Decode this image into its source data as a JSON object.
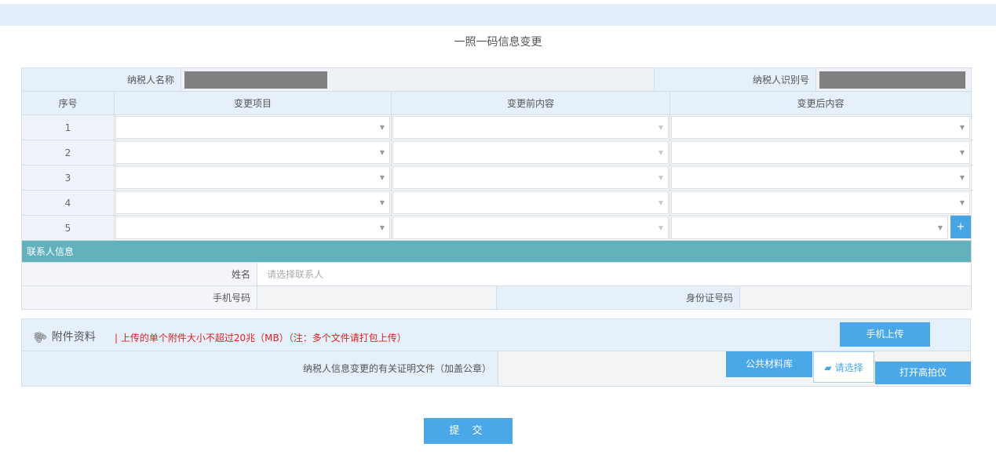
{
  "page": {
    "title": "一照一码信息变更"
  },
  "taxpayer": {
    "name_label": "纳税人名称",
    "id_label": "纳税人识别号"
  },
  "table": {
    "headers": [
      "序号",
      "变更项目",
      "变更前内容",
      "变更后内容"
    ],
    "rows": [
      "1",
      "2",
      "3",
      "4",
      "5"
    ],
    "add_button": "+"
  },
  "contact": {
    "section_title": "联系人信息",
    "name_label": "姓名",
    "name_placeholder": "请选择联系人",
    "phone_label": "手机号码",
    "idcard_label": "身份证号码"
  },
  "attachments": {
    "title": "附件资料",
    "note": "| 上传的单个附件大小不超过20兆（MB）（注：多个文件请打包上传）",
    "mobile_upload": "手机上传",
    "proof_label": "纳税人信息变更的有关证明文件（加盖公章）",
    "public_library": "公共材料库",
    "choose": "请选择",
    "scanner": "打开高拍仪"
  },
  "submit": "提 交",
  "colors": {
    "accent": "#4aa8e8",
    "header_bg": "#e6f0fa",
    "contact_bar": "#62b1bd",
    "note_red": "#e02020"
  }
}
